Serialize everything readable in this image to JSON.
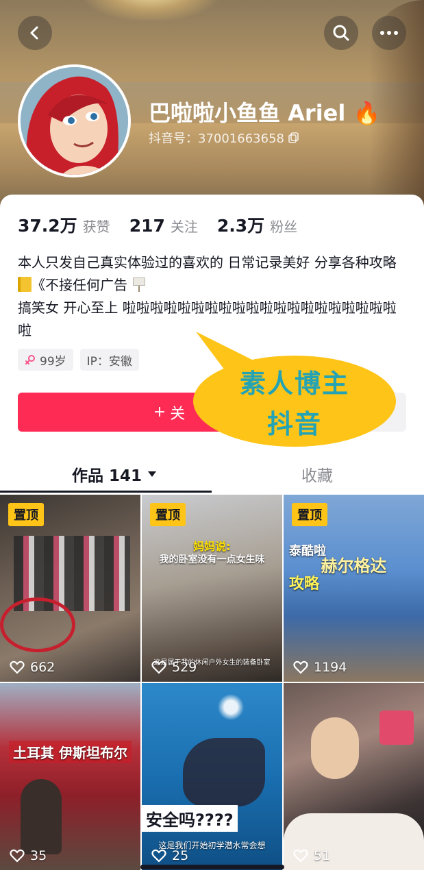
{
  "header": {
    "name": "巴啦啦小鱼鱼 Ariel",
    "name_emoji": "🔥",
    "douyin_id": "抖音号：37001663658"
  },
  "stats": [
    {
      "num": "37.2万",
      "label": "获赞"
    },
    {
      "num": "217",
      "label": "关注"
    },
    {
      "num": "2.3万",
      "label": "粉丝"
    }
  ],
  "bio": {
    "line1": "本人只发自己真实体验过的喜欢的 日常记录美好 分享各种攻略",
    "line1_tail": "《不接任何广告",
    "line2": "搞笑女 开心至上 啦啦啦啦啦啦啦啦啦啦啦啦啦啦啦啦啦啦啦啦啦"
  },
  "chips": {
    "age": "99岁",
    "ip": "IP：安徽"
  },
  "follow_label": "关",
  "bubble": {
    "line1": "素人博主",
    "line2": "抖音"
  },
  "tabs": {
    "works": "作品 141",
    "favorites": "收藏"
  },
  "videos": [
    {
      "pinned": "置顶",
      "likes": "662"
    },
    {
      "pinned": "置顶",
      "likes": "529",
      "caption_top": "妈妈说:",
      "caption_mid": "我的卧室没有一点女生味",
      "caption_bottom": "这是属于我的休闲户外女生的装备卧室"
    },
    {
      "pinned": "置顶",
      "likes": "1194",
      "caption_top": "泰酷啦",
      "caption_mid": "赫尔格达",
      "caption_bottom": "攻略"
    },
    {
      "likes": "35",
      "caption_top": "土耳其 伊斯坦布尔"
    },
    {
      "likes": "25",
      "safety": "安全吗????",
      "caption_bottom": "这是我们开始初学潜水常会想"
    },
    {
      "likes": "51"
    }
  ],
  "colors": {
    "accent": "#fe2c55",
    "badge": "#fec417",
    "bubble_text": "#24a3b5"
  }
}
